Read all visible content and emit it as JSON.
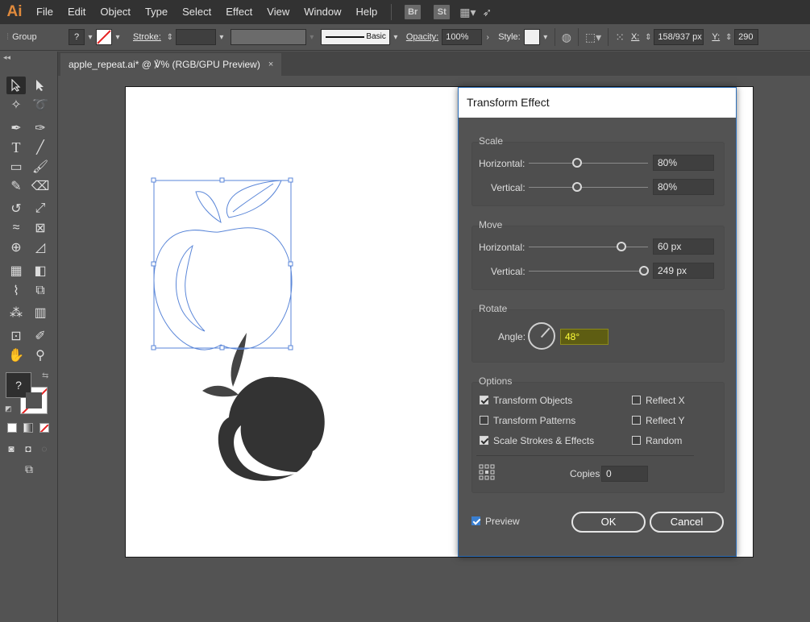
{
  "app": {
    "logo": "Ai"
  },
  "menu": [
    "File",
    "Edit",
    "Object",
    "Type",
    "Select",
    "Effect",
    "View",
    "Window",
    "Help"
  ],
  "menubar_icons": {
    "bridge": "Br",
    "stock": "St"
  },
  "controlbar": {
    "selection_type": "Group",
    "stroke_label": "Stroke:",
    "brush_label": "Basic",
    "opacity_label": "Opacity:",
    "opacity_value": "100%",
    "style_label": "Style:",
    "x_label": "X:",
    "x_value": "158/937 px",
    "y_label": "Y:",
    "y_value": "290"
  },
  "document_tab": {
    "title": "apple_repeat.ai* @ ℣% (RGB/GPU Preview)",
    "close": "×"
  },
  "toolbox": {
    "collapse": "◂◂",
    "fill_glyph": "?"
  },
  "dialog": {
    "title": "Transform Effect",
    "scale": {
      "title": "Scale",
      "horizontal_label": "Horizontal:",
      "horizontal_value": "80%",
      "horizontal_fraction": 0.4,
      "vertical_label": "Vertical:",
      "vertical_value": "80%",
      "vertical_fraction": 0.4
    },
    "move": {
      "title": "Move",
      "horizontal_label": "Horizontal:",
      "horizontal_value": "60 px",
      "horizontal_fraction": 0.77,
      "vertical_label": "Vertical:",
      "vertical_value": "249 px",
      "vertical_fraction": 0.95
    },
    "rotate": {
      "title": "Rotate",
      "angle_label": "Angle:",
      "angle_value": "48°"
    },
    "options": {
      "title": "Options",
      "transform_objects": {
        "label": "Transform Objects",
        "checked": true
      },
      "transform_patterns": {
        "label": "Transform Patterns",
        "checked": false
      },
      "scale_strokes": {
        "label": "Scale Strokes & Effects",
        "checked": true
      },
      "reflect_x": {
        "label": "Reflect X",
        "checked": false
      },
      "reflect_y": {
        "label": "Reflect Y",
        "checked": false
      },
      "random": {
        "label": "Random",
        "checked": false
      },
      "copies_label": "Copies",
      "copies_value": "0"
    },
    "preview": {
      "label": "Preview",
      "checked": true
    },
    "ok_label": "OK",
    "cancel_label": "Cancel"
  },
  "colors": {
    "selection_outline": "#5a86d8",
    "apple_fill": "#333333",
    "angle_highlight": "#ffff3a",
    "logo": "#e08a3c"
  }
}
